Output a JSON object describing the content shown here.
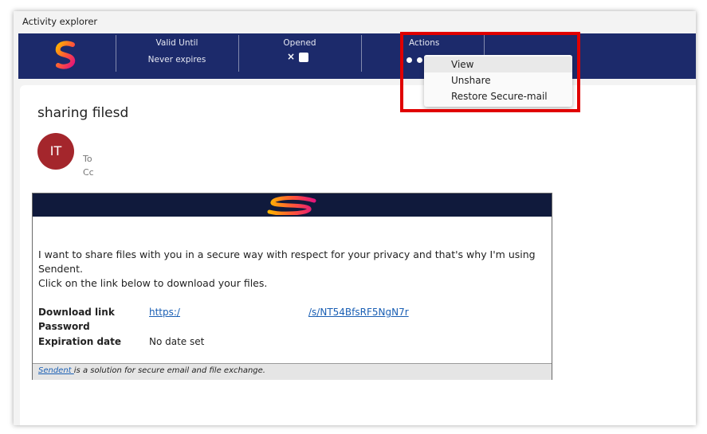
{
  "window": {
    "title": "Activity explorer"
  },
  "header": {
    "valid_until_label": "Valid Until",
    "valid_until_value": "Never expires",
    "opened_label": "Opened",
    "opened_value": "×",
    "actions_label": "Actions"
  },
  "actions_menu": {
    "items": [
      {
        "label": "View"
      },
      {
        "label": "Unshare"
      },
      {
        "label": "Restore Secure-mail"
      }
    ]
  },
  "message": {
    "subject": "sharing filesd",
    "avatar_initials": "IT",
    "to_label": "To",
    "cc_label": "Cc"
  },
  "email": {
    "body_line1": "I want to share files with you in a secure way with respect for your privacy and that's why I'm using Sendent.",
    "body_line2": "Click on the link below to download your files.",
    "download_label": "Download link",
    "download_link_part1": "https:/",
    "download_link_part2": "/s/NT54BfsRF5NgN7r",
    "password_label": "Password",
    "expiration_label": "Expiration date",
    "expiration_value": "No date set",
    "footer_link": "Sendent ",
    "footer_text": "is a solution for secure email and file exchange."
  },
  "colors": {
    "banner": "#1c2a6b",
    "avatar": "#a4262c",
    "highlight_box": "#e00000",
    "link": "#1a5fb4"
  }
}
